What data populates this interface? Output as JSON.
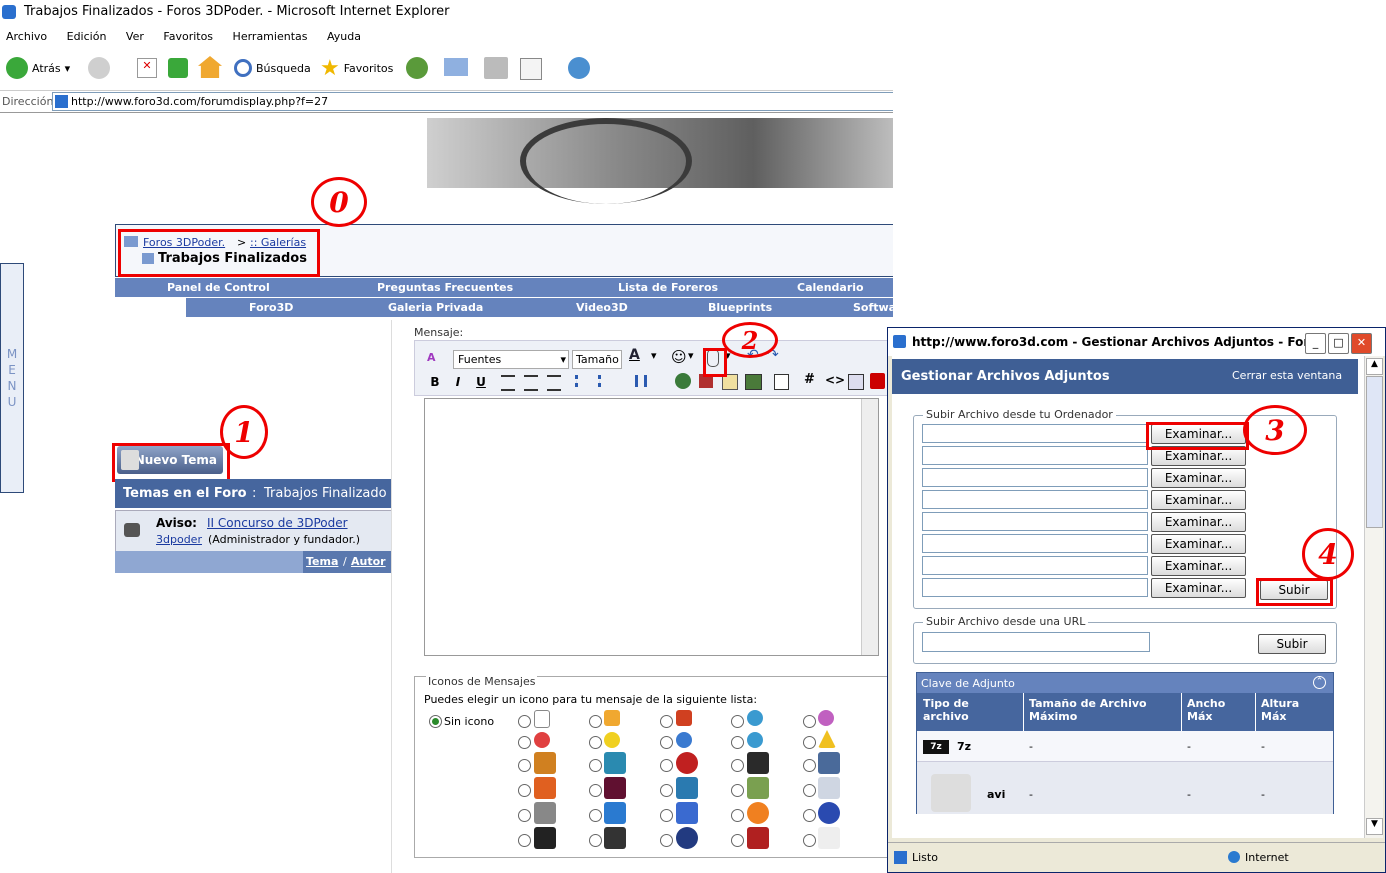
{
  "ie": {
    "title": "Trabajos Finalizados - Foros 3DPoder. - Microsoft Internet Explorer",
    "menu": [
      "Archivo",
      "Edición",
      "Ver",
      "Favoritos",
      "Herramientas",
      "Ayuda"
    ],
    "toolbar": {
      "back": "Atrás",
      "search": "Búsqueda",
      "favorites": "Favoritos"
    },
    "address_label": "Dirección",
    "address": "http://www.foro3d.com/forumdisplay.php?f=27"
  },
  "forum": {
    "crumb_root": "Foros 3DPoder.",
    "crumb_sep": ">",
    "crumb_child": ":: Galerías",
    "page_title": "Trabajos Finalizados",
    "nav1": [
      "Panel de Control",
      "Preguntas Frecuentes",
      "Lista de Foreros",
      "Calendario"
    ],
    "nav2": [
      "Foro3D",
      "Galeria Privada",
      "Video3D",
      "Blueprints",
      "Softwa"
    ],
    "side_menu": "MENU",
    "new_thread": "Nuevo Tema",
    "temas_label": "Temas en el Foro",
    "temas_sep": ":",
    "temas_value": "Trabajos Finalizado",
    "aviso_label": "Aviso:",
    "aviso_link": "II Concurso de 3DPoder",
    "aviso_user": "3dpoder",
    "aviso_role": "(Administrador y fundador.)",
    "col_tema": "Tema",
    "col_sep": "/",
    "col_autor": "Autor"
  },
  "annotations": {
    "n0": "0",
    "n1": "1",
    "n2": "2",
    "n3": "3",
    "n4": "4"
  },
  "editor": {
    "label": "Mensaje:",
    "font": "Fuentes",
    "size": "Tamaño",
    "bold": "B",
    "italic": "I",
    "underline": "U",
    "hash": "#",
    "code": "<>",
    "icons_legend": "Iconos de Mensajes",
    "icons_hint": "Puedes elegir un icono para tu mensaje de la siguiente lista:",
    "no_icon": "Sin icono"
  },
  "popup": {
    "title": "http://www.foro3d.com - Gestionar Archivos Adjuntos - For...",
    "header": "Gestionar Archivos Adjuntos",
    "close": "Cerrar esta ventana",
    "upload_legend": "Subir Archivo desde tu Ordenador",
    "browse": "Examinar...",
    "upload": "Subir",
    "url_legend": "Subir Archivo desde una URL",
    "table_title": "Clave de Adjunto",
    "cols": [
      "Tipo de archivo",
      "Tamaño de Archivo Máximo",
      "Ancho Máx",
      "Altura Máx"
    ],
    "rows": [
      {
        "type": "7z",
        "size": "-",
        "w": "-",
        "h": "-"
      },
      {
        "type": "avi",
        "size": "-",
        "w": "-",
        "h": "-"
      }
    ],
    "status_left": "Listo",
    "status_right": "Internet"
  },
  "colors": {
    "red": "#e00000",
    "navy": "#46669e",
    "nav": "#6583bd"
  }
}
